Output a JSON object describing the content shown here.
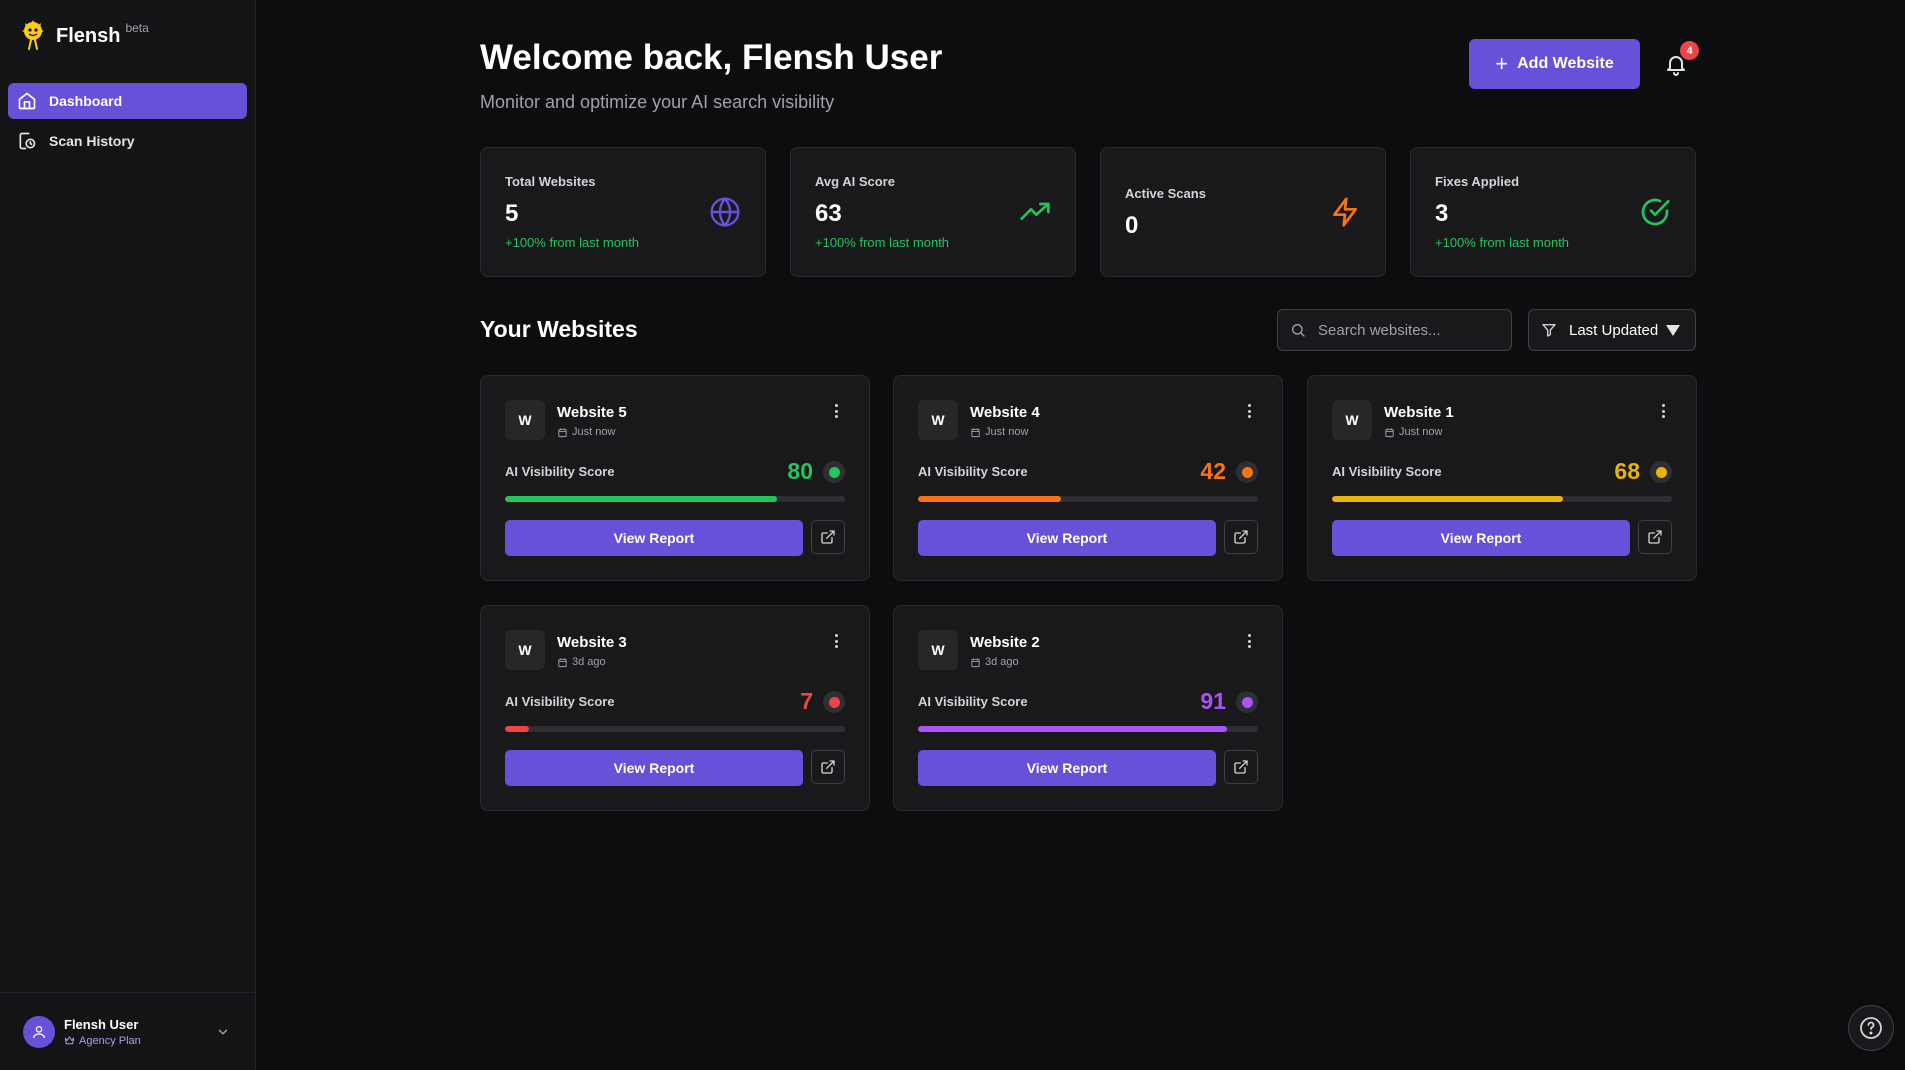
{
  "app": {
    "name": "Flensh",
    "badge": "beta"
  },
  "sidebar": {
    "items": [
      {
        "label": "Dashboard",
        "icon": "home-icon",
        "active": true
      },
      {
        "label": "Scan History",
        "icon": "history-icon",
        "active": false
      }
    ],
    "user": {
      "name": "Flensh User",
      "plan": "Agency Plan"
    }
  },
  "header": {
    "title": "Welcome back, Flensh User",
    "subtitle": "Monitor and optimize your AI search visibility",
    "add_button": "Add Website",
    "notification_count": "4"
  },
  "stats": [
    {
      "label": "Total Websites",
      "value": "5",
      "change": "+100% from last month",
      "icon": "globe-icon",
      "color": "#6552d8"
    },
    {
      "label": "Avg AI Score",
      "value": "63",
      "change": "+100% from last month",
      "icon": "trending-up-icon",
      "color": "#22c55e"
    },
    {
      "label": "Active Scans",
      "value": "0",
      "change": "",
      "icon": "lightning-icon",
      "color": "#f97316"
    },
    {
      "label": "Fixes Applied",
      "value": "3",
      "change": "+100% from last month",
      "icon": "check-circle-icon",
      "color": "#22c55e"
    }
  ],
  "websites_section": {
    "title": "Your Websites",
    "search_placeholder": "Search websites...",
    "sort_label": "Last Updated"
  },
  "websites": [
    {
      "initial": "W",
      "name": "Website 5",
      "time": "Just now",
      "score_label": "AI Visibility Score",
      "score": 80,
      "color": "#22c55e",
      "action": "View Report"
    },
    {
      "initial": "W",
      "name": "Website 4",
      "time": "Just now",
      "score_label": "AI Visibility Score",
      "score": 42,
      "color": "#f97316",
      "action": "View Report"
    },
    {
      "initial": "W",
      "name": "Website 1",
      "time": "Just now",
      "score_label": "AI Visibility Score",
      "score": 68,
      "color": "#eab308",
      "action": "View Report"
    },
    {
      "initial": "W",
      "name": "Website 3",
      "time": "3d ago",
      "score_label": "AI Visibility Score",
      "score": 7,
      "color": "#ef4444",
      "action": "View Report"
    },
    {
      "initial": "W",
      "name": "Website 2",
      "time": "3d ago",
      "score_label": "AI Visibility Score",
      "score": 91,
      "color": "#a855f7",
      "action": "View Report"
    }
  ]
}
